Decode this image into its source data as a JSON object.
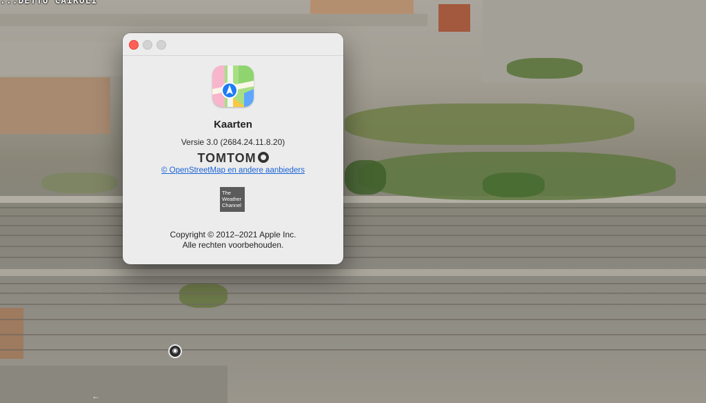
{
  "map": {
    "street_label": "...DETTO CAIROLI",
    "poi_icon": "poi-pin-icon"
  },
  "window": {
    "traffic_lights": [
      "close",
      "minimize",
      "zoom"
    ],
    "app_icon": "maps-app-icon",
    "app_name": "Kaarten",
    "version": "Versie 3.0 (2684.24.11.8.20)",
    "tomtom_logo_text": "TOMTOM",
    "osm_link": "© OpenStreetMap en andere aanbieders",
    "weather_logo_text": "The Weather Channel",
    "copyright_line1": "Copyright © 2012–2021 Apple Inc.",
    "copyright_line2": "Alle rechten voorbehouden."
  },
  "colors": {
    "close": "#fe5f57",
    "link": "#1a63d6",
    "window_bg": "#ececec"
  }
}
